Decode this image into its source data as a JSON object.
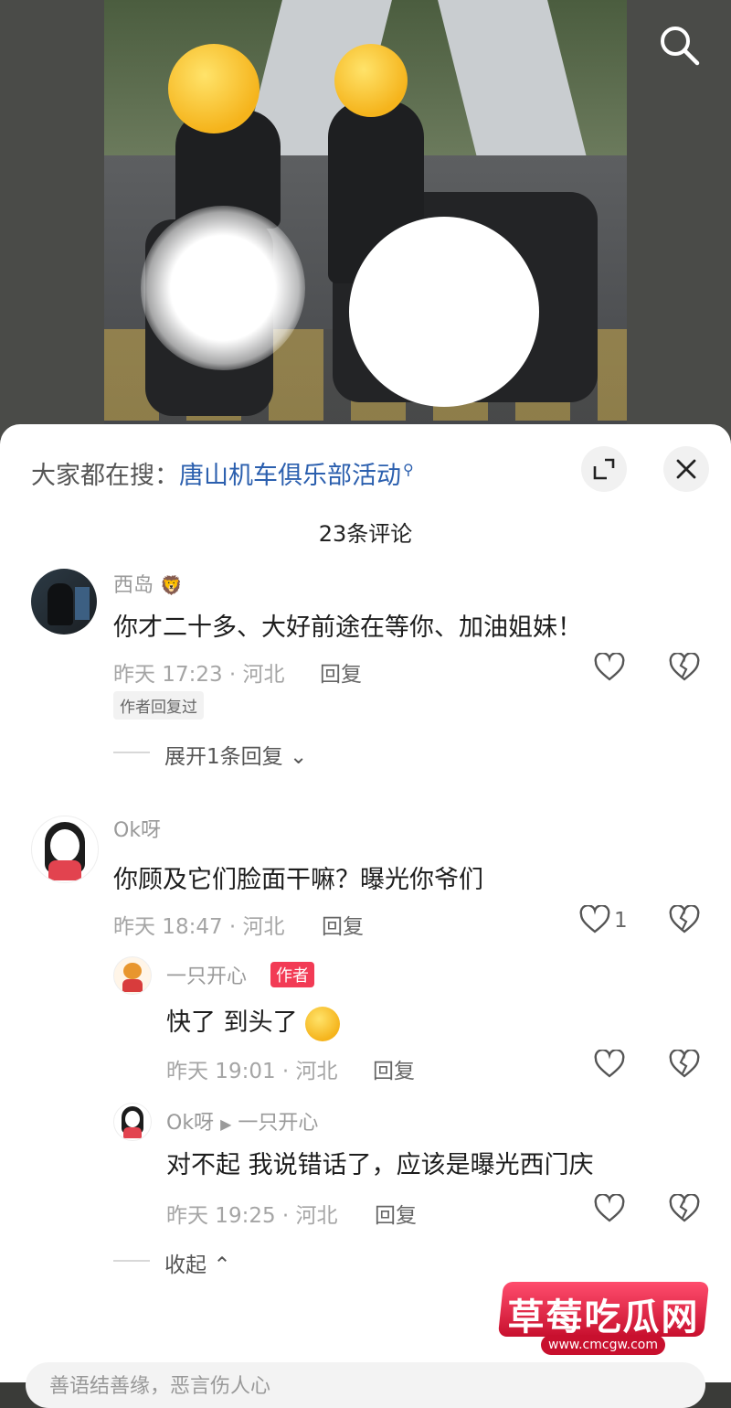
{
  "trending": {
    "prefix": "大家都在搜：",
    "keyword": "唐山机车俱乐部活动"
  },
  "comment_count": "23条评论",
  "comments": [
    {
      "user": "西岛",
      "text": "你才二十多、大好前途在等你、加油姐妹！",
      "time": "昨天 17:23 · 河北",
      "reply_label": "回复",
      "tag": "作者回复过",
      "expand_label": "展开1条回复"
    },
    {
      "user": "Ok呀",
      "text": "你顾及它们脸面干嘛？曝光你爷们",
      "time": "昨天 18:47 · 河北",
      "reply_label": "回复",
      "likes": "1",
      "replies": [
        {
          "user": "一只开心",
          "badge": "作者",
          "text": "快了 到头了",
          "time": "昨天 19:01 · 河北",
          "reply_label": "回复"
        },
        {
          "user": "Ok呀",
          "reply_to": "一只开心",
          "text": "对不起 我说错话了，应该是曝光西门庆",
          "time": "昨天 19:25 · 河北",
          "reply_label": "回复"
        }
      ],
      "collapse_label": "收起"
    }
  ],
  "watermark": {
    "title": "草莓吃瓜网",
    "url": "www.cmcgw.com"
  },
  "input_placeholder": "善语结善缘，恶言伤人心"
}
